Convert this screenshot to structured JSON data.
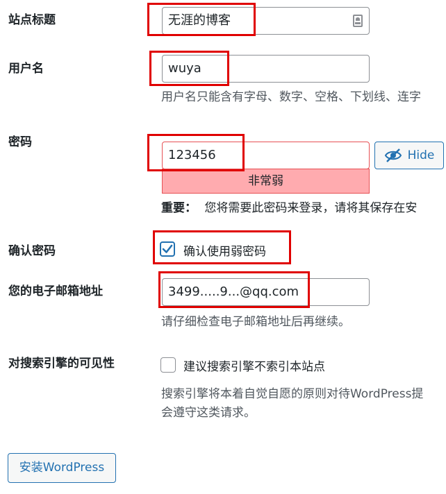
{
  "site_title": {
    "label": "站点标题",
    "value": "无涯的博客"
  },
  "username": {
    "label": "用户名",
    "value": "wuya",
    "description": "用户名只能含有字母、数字、空格、下划线、连字"
  },
  "password": {
    "label": "密码",
    "value": "123456",
    "hide_button_label": "Hide",
    "strength_text": "非常弱",
    "note_bold": "重要：",
    "note_text": "您将需要此密码来登录，请将其保存在安"
  },
  "confirm_password": {
    "label": "确认密码",
    "checkbox_label": "确认使用弱密码",
    "checked": true
  },
  "email": {
    "label": "您的电子邮箱地址",
    "value": "3499.....9...@qq.com",
    "description": "请仔细检查电子邮箱地址后再继续。"
  },
  "visibility": {
    "label": "对搜索引擎的可见性",
    "checkbox_label": "建议搜索引擎不索引本站点",
    "checked": false,
    "description_line1": "搜索引擎将本着自觉自愿的原则对待WordPress提",
    "description_line2": "会遵守这类请求。"
  },
  "install_button_label": "安装WordPress",
  "colors": {
    "accent": "#2271b1",
    "annotation_box": "#e00000",
    "weak_strength_bg": "#ffabaf"
  }
}
